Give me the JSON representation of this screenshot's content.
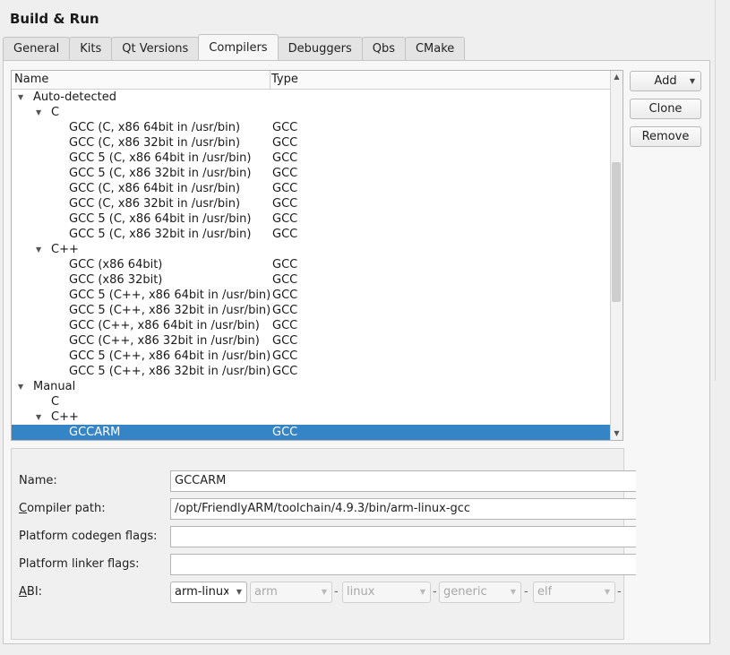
{
  "window": {
    "title": "Build & Run"
  },
  "tabs": [
    {
      "label": "General",
      "active": false
    },
    {
      "label": "Kits",
      "active": false
    },
    {
      "label": "Qt Versions",
      "active": false
    },
    {
      "label": "Compilers",
      "active": true
    },
    {
      "label": "Debuggers",
      "active": false
    },
    {
      "label": "Qbs",
      "active": false
    },
    {
      "label": "CMake",
      "active": false
    }
  ],
  "tree": {
    "columns": {
      "name": "Name",
      "type": "Type"
    },
    "groups": [
      {
        "label": "Auto-detected",
        "languages": [
          {
            "label": "C",
            "items": [
              {
                "name": "GCC (C, x86 64bit in /usr/bin)",
                "type": "GCC"
              },
              {
                "name": "GCC (C, x86 32bit in /usr/bin)",
                "type": "GCC"
              },
              {
                "name": "GCC 5 (C, x86 64bit in /usr/bin)",
                "type": "GCC"
              },
              {
                "name": "GCC 5 (C, x86 32bit in /usr/bin)",
                "type": "GCC"
              },
              {
                "name": "GCC (C, x86 64bit in /usr/bin)",
                "type": "GCC"
              },
              {
                "name": "GCC (C, x86 32bit in /usr/bin)",
                "type": "GCC"
              },
              {
                "name": "GCC 5 (C, x86 64bit in /usr/bin)",
                "type": "GCC"
              },
              {
                "name": "GCC 5 (C, x86 32bit in /usr/bin)",
                "type": "GCC"
              }
            ]
          },
          {
            "label": "C++",
            "items": [
              {
                "name": "GCC (x86 64bit)",
                "type": "GCC"
              },
              {
                "name": "GCC (x86 32bit)",
                "type": "GCC"
              },
              {
                "name": "GCC 5 (C++, x86 64bit in /usr/bin)",
                "type": "GCC"
              },
              {
                "name": "GCC 5 (C++, x86 32bit in /usr/bin)",
                "type": "GCC"
              },
              {
                "name": "GCC (C++, x86 64bit in /usr/bin)",
                "type": "GCC"
              },
              {
                "name": "GCC (C++, x86 32bit in /usr/bin)",
                "type": "GCC"
              },
              {
                "name": "GCC 5 (C++, x86 64bit in /usr/bin)",
                "type": "GCC"
              },
              {
                "name": "GCC 5 (C++, x86 32bit in /usr/bin)",
                "type": "GCC"
              }
            ]
          }
        ]
      },
      {
        "label": "Manual",
        "languages": [
          {
            "label": "C",
            "items": []
          },
          {
            "label": "C++",
            "items": [
              {
                "name": "GCCARM",
                "type": "GCC",
                "selected": true
              }
            ]
          }
        ]
      }
    ]
  },
  "buttons": {
    "add": "Add",
    "clone": "Clone",
    "remove": "Remove"
  },
  "details": {
    "name_label": "Name:",
    "name_value": "GCCARM",
    "compiler_path_label_first": "C",
    "compiler_path_label_rest": "ompiler path:",
    "compiler_path_value": "/opt/FriendlyARM/toolchain/4.9.3/bin/arm-linux-gcc",
    "codegen_flags_label": "Platform codegen flags:",
    "codegen_flags_value": "",
    "linker_flags_label": "Platform linker flags:",
    "linker_flags_value": "",
    "abi_label_first": "A",
    "abi_label_rest": "BI:",
    "abi": {
      "preset": "arm-linux",
      "architecture": "arm",
      "os": "linux",
      "flavor": "generic",
      "format": "elf",
      "separator": "-"
    }
  },
  "colors": {
    "selection": "#3584c6",
    "selection_text": "#ffffff"
  },
  "icons": {
    "expanded": "chevron-down-icon",
    "dropdown": "dropdown-arrow-icon"
  }
}
